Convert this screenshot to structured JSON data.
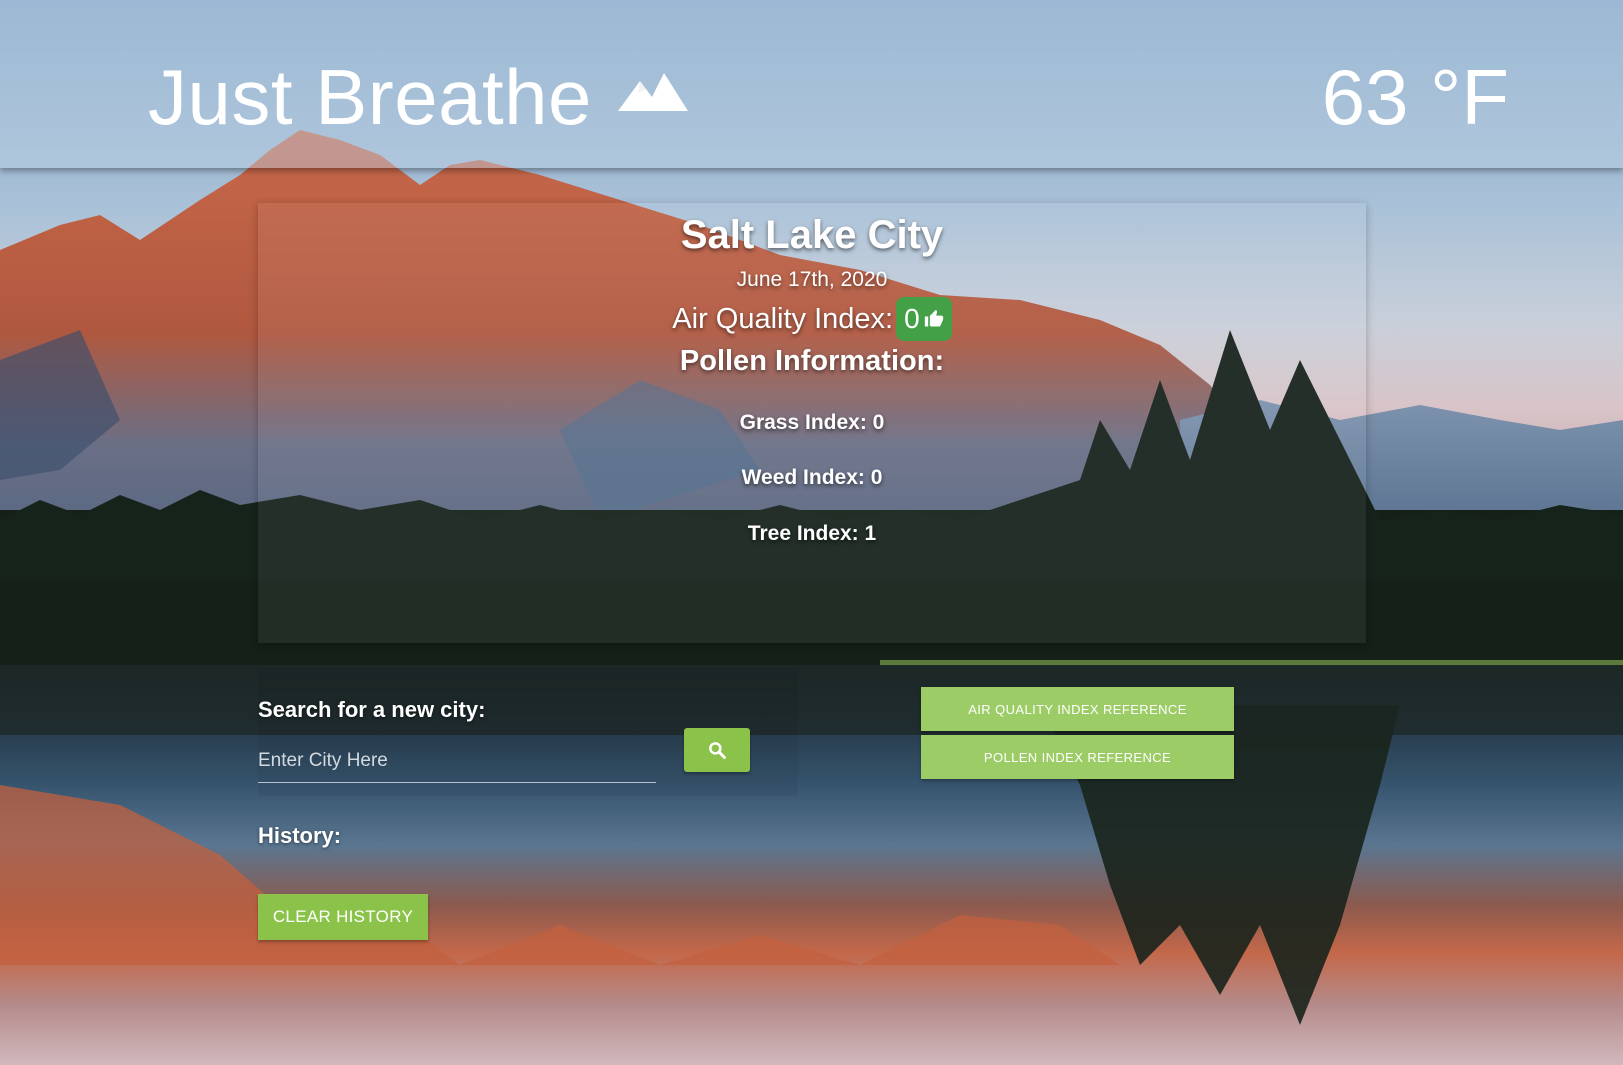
{
  "header": {
    "title": "Just Breathe",
    "logo_icon": "mountain-icon",
    "temperature": "63 °F"
  },
  "weather": {
    "city": "Salt Lake City",
    "date": "June 17th, 2020",
    "aqi_label": "Air Quality Index:",
    "aqi_value": "0",
    "aqi_icon": "thumbs-up-icon",
    "aqi_color": "#43a047",
    "pollen_title": "Pollen Information:",
    "grass": "Grass Index: 0",
    "weed": "Weed Index: 0",
    "tree": "Tree Index: 1"
  },
  "search": {
    "label": "Search for a new city:",
    "placeholder": "Enter City Here",
    "button_icon": "search-icon"
  },
  "history": {
    "label": "History:",
    "clear_label": "CLEAR HISTORY"
  },
  "references": {
    "aqi_label": "AIR QUALITY INDEX REFERENCE",
    "pollen_label": "POLLEN INDEX REFERENCE"
  },
  "colors": {
    "button_green": "#8bc34a",
    "reference_green": "#9ccc65"
  }
}
